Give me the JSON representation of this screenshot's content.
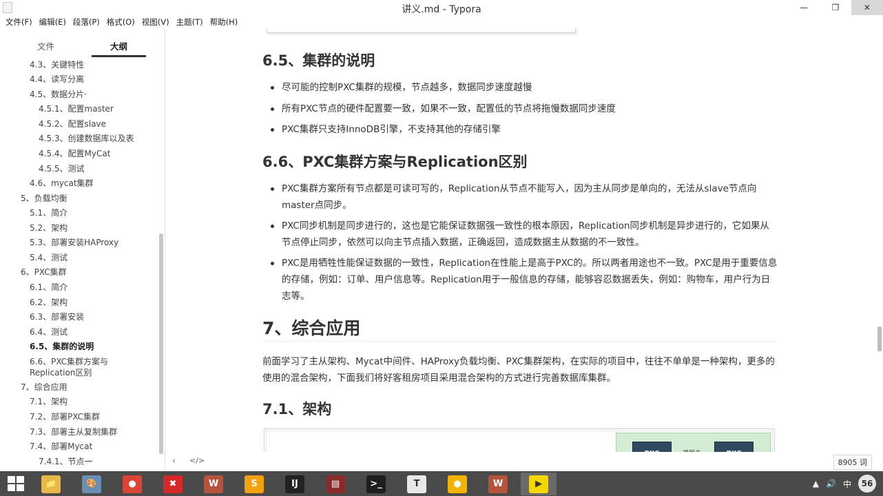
{
  "window": {
    "title": "讲义.md - Typora",
    "min_icon": "minimize-icon",
    "max_icon": "restore-icon",
    "close_icon": "close-icon",
    "min_glyph": "—",
    "max_glyph": "❐",
    "close_glyph": "✕"
  },
  "menu": [
    "文件(F)",
    "编辑(E)",
    "段落(P)",
    "格式(O)",
    "视图(V)",
    "主题(T)",
    "帮助(H)"
  ],
  "sidebar": {
    "tab_files": "文件",
    "tab_outline": "大纲",
    "items": [
      {
        "label": "4.3、关键特性"
      },
      {
        "label": "4.4、读写分离"
      },
      {
        "label": "4.5、数据分片·"
      },
      {
        "label": "4.5.1、配置master"
      },
      {
        "label": "4.5.2、配置slave"
      },
      {
        "label": "4.5.3、创建数据库以及表"
      },
      {
        "label": "4.5.4、配置MyCat"
      },
      {
        "label": "4.5.5、测试"
      },
      {
        "label": "4.6、mycat集群"
      },
      {
        "label": "5、负载均衡"
      },
      {
        "label": "5.1、简介"
      },
      {
        "label": "5.2、架构"
      },
      {
        "label": "5.3、部署安装HAProxy"
      },
      {
        "label": "5.4、测试"
      },
      {
        "label": "6、PXC集群"
      },
      {
        "label": "6.1、简介"
      },
      {
        "label": "6.2、架构"
      },
      {
        "label": "6.3、部署安装"
      },
      {
        "label": "6.4、测试"
      },
      {
        "label": "6.5、集群的说明"
      },
      {
        "label": "6.6、PXC集群方案与"
      },
      {
        "label": "Replication区别"
      },
      {
        "label": "7、综合应用"
      },
      {
        "label": "7.1、架构"
      },
      {
        "label": "7.2、部署PXC集群"
      },
      {
        "label": "7.3、部署主从复制集群"
      },
      {
        "label": "7.4、部署Mycat"
      },
      {
        "label": "7.4.1、节点一"
      }
    ]
  },
  "doc": {
    "h_65": "6.5、集群的说明",
    "b65_1": "尽可能的控制PXC集群的规模，节点越多，数据同步速度越慢",
    "b65_2": "所有PXC节点的硬件配置要一致，如果不一致，配置低的节点将拖慢数据同步速度",
    "b65_3": "PXC集群只支持InnoDB引擎，不支持其他的存储引擎",
    "h_66": "6.6、PXC集群方案与Replication区别",
    "b66_1": "PXC集群方案所有节点都是可读可写的，Replication从节点不能写入，因为主从同步是单向的，无法从slave节点向master点同步。",
    "b66_2": "PXC同步机制是同步进行的，这也是它能保证数据强一致性的根本原因，Replication同步机制是异步进行的，它如果从节点停止同步，依然可以向主节点插入数据，正确返回，造成数据主从数据的不一致性。",
    "b66_3": "PXC是用牺牲性能保证数据的一致性，Replication在性能上是高于PXC的。所以两者用途也不一致。PXC是用于重要信息的存储，例如：订单、用户信息等。Replication用于一般信息的存储，能够容忍数据丢失，例如：购物车，用户行为日志等。",
    "h_7": "7、综合应用",
    "p_7": "前面学习了主从架构、Mycat中间件、HAProxy负载均衡、PXC集群架构，在实际的项目中，往往不单单是一种架构，更多的使用的混合架构，下面我们将好客租房项目采用混合架构的方式进行完善数据库集群。",
    "h_71": "7.1、架构",
    "diagram_node1": "PXC",
    "diagram_node2": "PXC",
    "diagram_sync": "强同步"
  },
  "statusbar": {
    "back_glyph": "‹",
    "code_glyph": "</>",
    "word_count": "8905 词"
  },
  "taskbar": {
    "apps": [
      {
        "name": "file-explorer-icon",
        "glyph": "📁",
        "color": "#e8b84a"
      },
      {
        "name": "paint-icon",
        "glyph": "🎨",
        "color": "#6a8fb5"
      },
      {
        "name": "chrome-icon",
        "glyph": "●",
        "color": "#db4437"
      },
      {
        "name": "xmind-icon",
        "glyph": "✖",
        "color": "#d62828"
      },
      {
        "name": "editor-icon",
        "glyph": "W",
        "color": "#b5533c"
      },
      {
        "name": "sublime-icon",
        "glyph": "S",
        "color": "#f2a20c"
      },
      {
        "name": "intellij-icon",
        "glyph": "IJ",
        "color": "#222222"
      },
      {
        "name": "winrar-icon",
        "glyph": "▤",
        "color": "#8a2b2b"
      },
      {
        "name": "terminal-icon",
        "glyph": ">_",
        "color": "#1e1e1e"
      },
      {
        "name": "typora-icon",
        "glyph": "T",
        "color": "#e9e9e9"
      },
      {
        "name": "chat-icon",
        "glyph": "●",
        "color": "#f2b400"
      },
      {
        "name": "editor2-icon",
        "glyph": "W",
        "color": "#b5533c"
      },
      {
        "name": "video-recorder-icon",
        "glyph": "▶",
        "color": "#f6d600"
      }
    ],
    "tray_arrow": "▲",
    "tray_speaker": "🔊",
    "tray_ime": "中",
    "tray_badge": "56"
  }
}
